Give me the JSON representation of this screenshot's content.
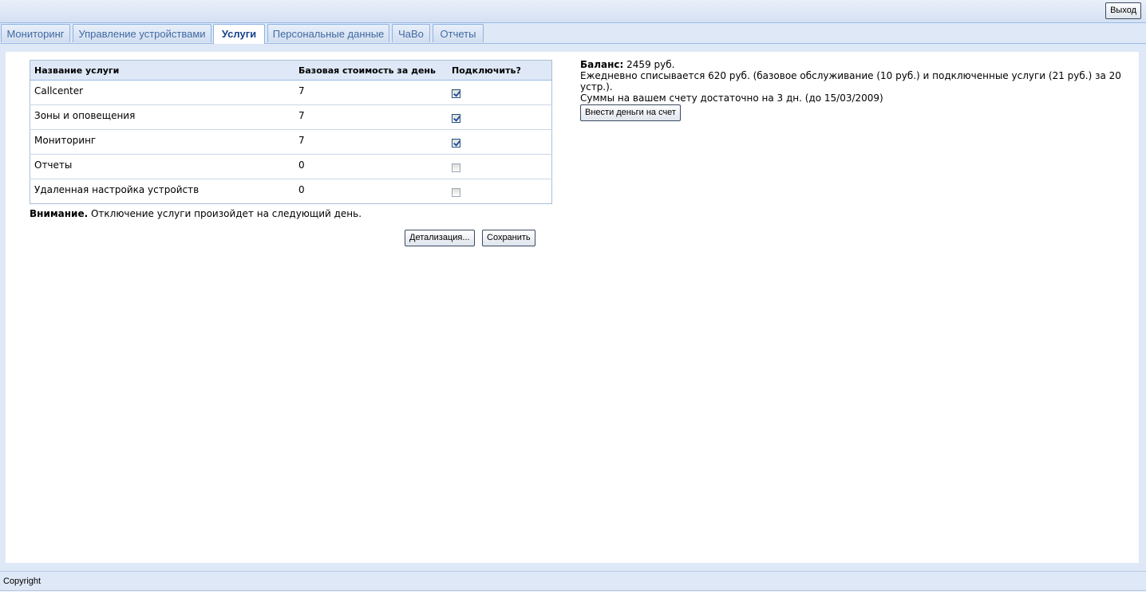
{
  "header": {
    "logout_label": "Выход"
  },
  "tabs": [
    {
      "label": "Мониторинг",
      "active": false
    },
    {
      "label": "Управление устройствами",
      "active": false
    },
    {
      "label": "Услуги",
      "active": true
    },
    {
      "label": "Персональные данные",
      "active": false
    },
    {
      "label": "ЧаВо",
      "active": false
    },
    {
      "label": "Отчеты",
      "active": false
    }
  ],
  "services": {
    "columns": [
      "Название услуги",
      "Базовая стоимость за день",
      "Подключить?"
    ],
    "rows": [
      {
        "name": "Callcenter",
        "price": "7",
        "enabled": true
      },
      {
        "name": "Зоны и оповещения",
        "price": "7",
        "enabled": true
      },
      {
        "name": "Мониторинг",
        "price": "7",
        "enabled": true
      },
      {
        "name": "Отчеты",
        "price": "0",
        "enabled": false
      },
      {
        "name": "Удаленная настройка устройств",
        "price": "0",
        "enabled": false
      }
    ],
    "warning_bold": "Внимание.",
    "warning_text": " Отключение услуги произойдет на следующий день.",
    "details_label": "Детализация...",
    "save_label": "Сохранить"
  },
  "balance": {
    "label": "Баланс:",
    "value": " 2459 руб.",
    "daily_text": "Ежедневно списывается 620 руб. (базовое обслуживание (10 руб.) и подключенные услуги (21 руб.) за 20 устр.).",
    "sufficient_text": "Суммы на вашем счету достаточно на 3 дн. (до 15/03/2009)",
    "pay_label": "Внести деньги на счет"
  },
  "footer": {
    "copyright": "Copyright"
  }
}
